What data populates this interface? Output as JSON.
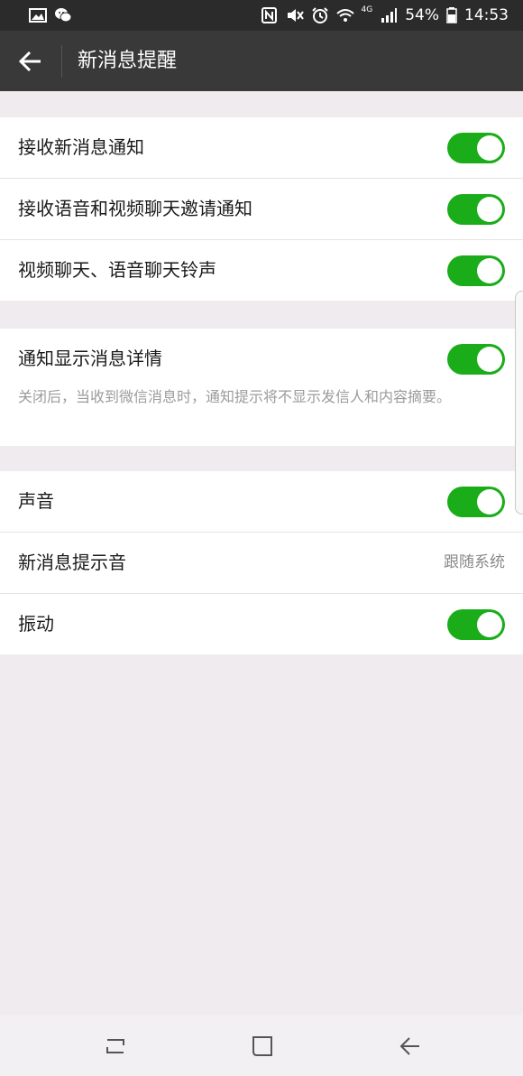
{
  "status_bar": {
    "battery": "54%",
    "time": "14:53",
    "network": "4G",
    "icons": [
      "gallery-icon",
      "wechat-icon",
      "nfc-icon",
      "mute-icon",
      "alarm-icon",
      "wifi-icon",
      "signal-icon",
      "battery-icon"
    ]
  },
  "action_bar": {
    "title": "新消息提醒",
    "back_icon": "back-arrow-icon"
  },
  "groups": [
    {
      "rows": [
        {
          "label": "接收新消息通知",
          "toggle": true
        },
        {
          "label": "接收语音和视频聊天邀请通知",
          "toggle": true
        },
        {
          "label": "视频聊天、语音聊天铃声",
          "toggle": true
        }
      ]
    },
    {
      "rows": [
        {
          "label": "通知显示消息详情",
          "toggle": true,
          "description": "关闭后，当收到微信消息时，通知提示将不显示发信人和内容摘要。"
        }
      ]
    },
    {
      "rows": [
        {
          "label": "声音",
          "toggle": true
        },
        {
          "label": "新消息提示音",
          "value": "跟随系统"
        },
        {
          "label": "振动",
          "toggle": true
        }
      ]
    }
  ],
  "colors": {
    "toggle_on": "#1aad19",
    "action_bar": "#393939",
    "status_bar": "#2b2b2b",
    "page_bg": "#efebee"
  },
  "nav_bar": {
    "icons": [
      "recent-apps-icon",
      "home-icon",
      "back-icon"
    ]
  }
}
